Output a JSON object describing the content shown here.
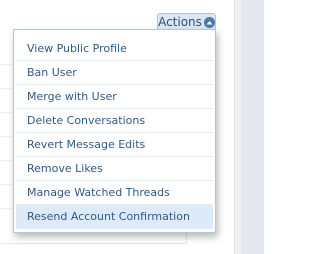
{
  "actions_button": {
    "label": "Actions",
    "icon": "chevron-up-icon"
  },
  "menu": {
    "items": [
      {
        "label": "View Public Profile"
      },
      {
        "label": "Ban User"
      },
      {
        "label": "Merge with User"
      },
      {
        "label": "Delete Conversations"
      },
      {
        "label": "Revert Message Edits"
      },
      {
        "label": "Remove Likes"
      },
      {
        "label": "Manage Watched Threads"
      },
      {
        "label": "Resend Account Confirmation"
      }
    ],
    "highlighted_index": 7
  },
  "colors": {
    "link": "#2f5a87",
    "menu_border": "#b4c6da",
    "hover_bg": "#dcebf7",
    "button_bg": "#dbe6f1"
  }
}
